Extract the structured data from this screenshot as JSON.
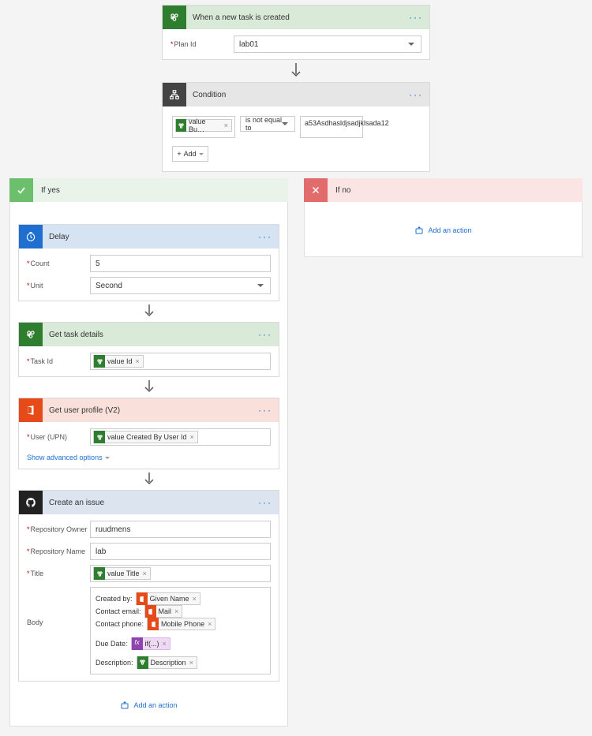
{
  "trigger": {
    "title": "When a new task is created",
    "planIdLabel": "Plan Id",
    "planIdValue": "lab01"
  },
  "condition": {
    "title": "Condition",
    "leftToken": "value Bu…",
    "operator": "is not equal to",
    "rightValue": "a53Asdhasldjsadjklsada12",
    "addLabel": "Add"
  },
  "branches": {
    "yesLabel": "If yes",
    "noLabel": "If no",
    "addAction": "Add an action"
  },
  "delay": {
    "title": "Delay",
    "countLabel": "Count",
    "countValue": "5",
    "unitLabel": "Unit",
    "unitValue": "Second"
  },
  "getTask": {
    "title": "Get task details",
    "taskIdLabel": "Task Id",
    "taskIdToken": "value Id"
  },
  "getUser": {
    "title": "Get user profile (V2)",
    "userLabel": "User (UPN)",
    "userToken": "value Created By User Id",
    "advanced": "Show advanced options"
  },
  "issue": {
    "title": "Create an issue",
    "repoOwnerLabel": "Repository Owner",
    "repoOwnerValue": "ruudmens",
    "repoNameLabel": "Repository Name",
    "repoNameValue": "lab",
    "titleLabel": "Title",
    "titleToken": "value Title",
    "bodyLabel": "Body",
    "bodyLines": {
      "createdBy": "Created by:",
      "givenNameToken": "Given Name",
      "contactEmail": "Contact email:",
      "mailToken": "Mail",
      "contactPhone": "Contact phone:",
      "mobileToken": "Mobile Phone",
      "dueDate": "Due Date:",
      "fxToken": "if(...)",
      "description": "Description:",
      "descToken": "Description"
    }
  }
}
